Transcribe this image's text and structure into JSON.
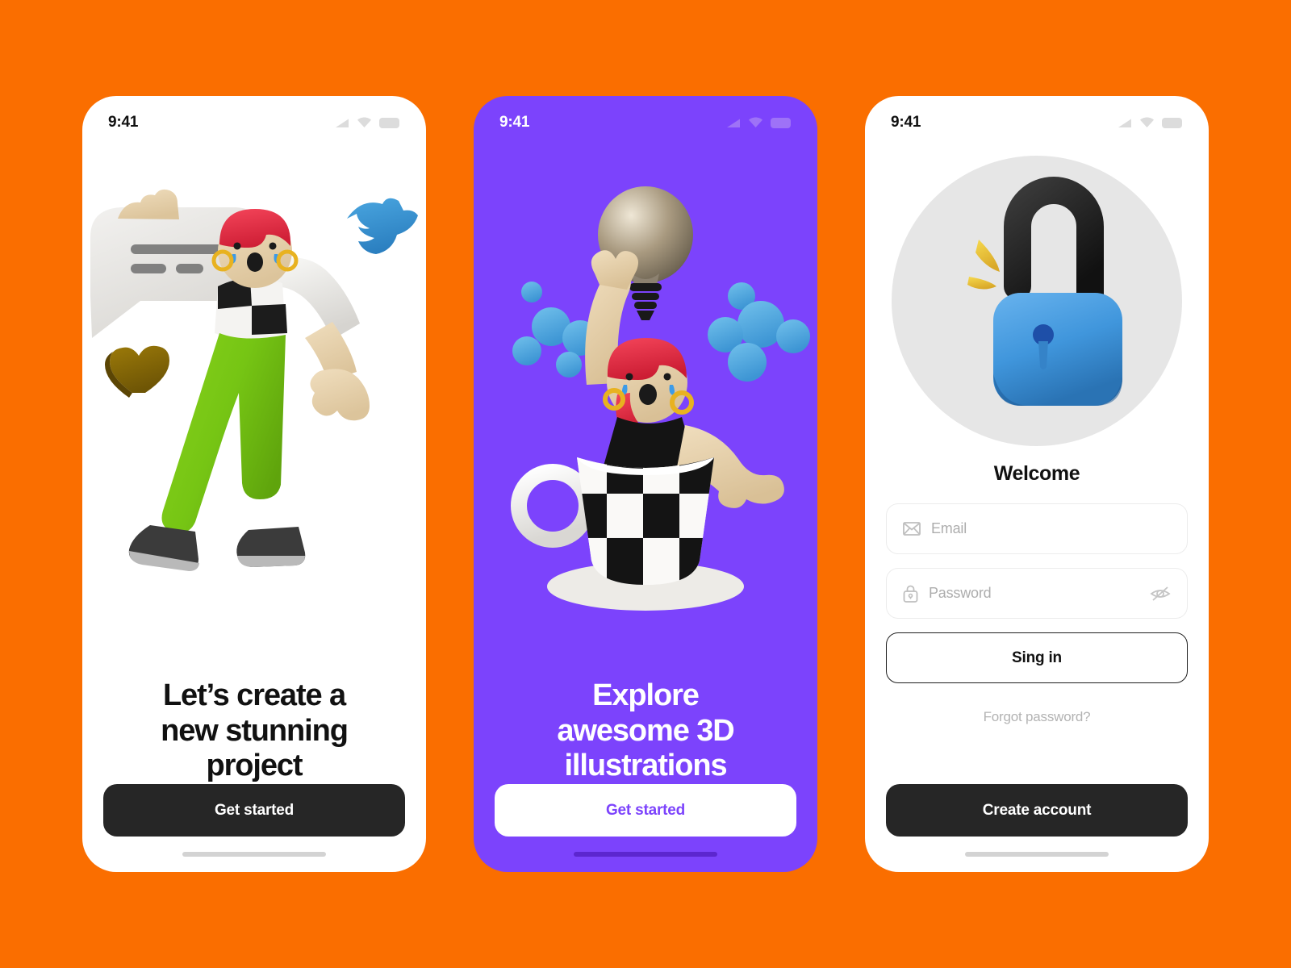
{
  "theme": {
    "page_background": "#FA6E00",
    "purple": "#7C43FC",
    "dark": "#262626",
    "white": "#FFFFFF",
    "muted_text": "#ADADAD"
  },
  "screens": [
    {
      "id": "onboarding-1",
      "status_bar": {
        "time": "9:41",
        "icons": [
          "signal-icon",
          "wifi-icon",
          "battery-icon"
        ]
      },
      "illustration": {
        "name": "character-with-speech-bubble",
        "elements": [
          "speech-bubble",
          "blue-bird",
          "gold-heart",
          "character-red-hair-green-pants"
        ]
      },
      "headline": "Let’s create a\nnew stunning\nproject",
      "cta_label": "Get started"
    },
    {
      "id": "onboarding-2",
      "status_bar": {
        "time": "9:41",
        "icons": [
          "signal-icon",
          "wifi-icon",
          "battery-icon"
        ]
      },
      "illustration": {
        "name": "character-in-checkered-teacup",
        "elements": [
          "lightbulb",
          "blue-molecules",
          "checkered-teacup",
          "character-red-hair"
        ]
      },
      "headline": "Explore\nawesome 3D\nillustrations",
      "cta_label": "Get started"
    },
    {
      "id": "sign-in",
      "status_bar": {
        "time": "9:41",
        "icons": [
          "signal-icon",
          "wifi-icon",
          "battery-icon"
        ]
      },
      "illustration": {
        "name": "blue-padlock-unlocked",
        "elements": [
          "gray-circle-backdrop",
          "black-shackle",
          "blue-lock-body",
          "yellow-sparks"
        ]
      },
      "heading": "Welcome",
      "fields": [
        {
          "name": "email",
          "placeholder": "Email",
          "leading_icon": "envelope-icon",
          "value": ""
        },
        {
          "name": "password",
          "placeholder": "Password",
          "leading_icon": "lock-icon",
          "trailing_icon": "eye-off-icon",
          "value": ""
        }
      ],
      "signin_label": "Sing in",
      "forgot_label": "Forgot password?",
      "cta_label": "Create account"
    }
  ]
}
